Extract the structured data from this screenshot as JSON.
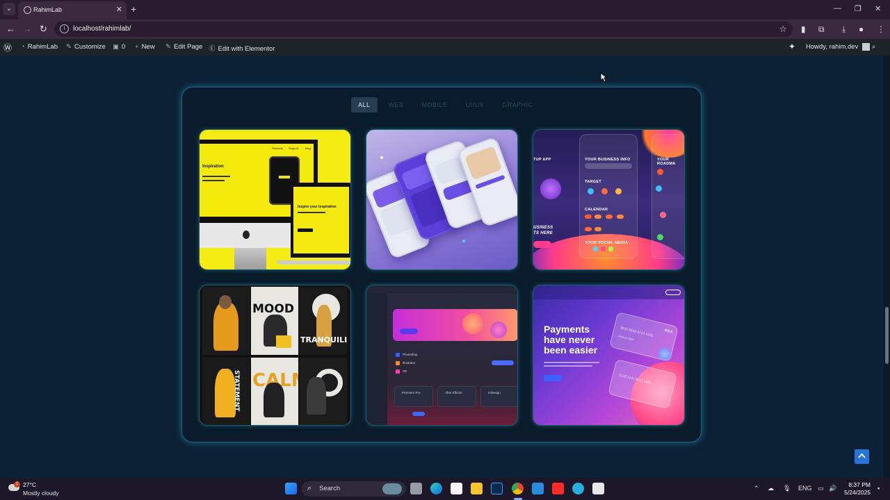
{
  "browser": {
    "tab_title": "RahimLab",
    "url": "localhost/rahimlab/",
    "window_controls": [
      "—",
      "❐",
      "✕"
    ]
  },
  "wp_admin_bar": {
    "site_name": "RahimLab",
    "customize": "Customize",
    "comments_count": "0",
    "new": "New",
    "edit_page": "Edit Page",
    "edit_elementor": "Edit with Elementor",
    "howdy": "Howdy, rahim.dev"
  },
  "portfolio": {
    "filters": [
      "ALL",
      "WEB",
      "MOBILE",
      "UI/UX",
      "GRAPHIC"
    ],
    "active_filter": "ALL",
    "items": [
      {
        "name": "yellow-web-mockup"
      },
      {
        "name": "mobile-app-mockup"
      },
      {
        "name": "startup-app-ui"
      },
      {
        "name": "poster-design-set"
      },
      {
        "name": "dashboard-ui"
      },
      {
        "name": "payments-landing"
      }
    ],
    "card1": {
      "heading": "Inspiration",
      "subheading": "Inspire your inspiration",
      "nav": [
        "Products",
        "Support",
        "Blog"
      ]
    },
    "card3": {
      "app_label": "TUP APP",
      "business_info": "YOUR BUSINESS INFO",
      "target": "TARGET",
      "calendar": "CALENDAR",
      "social": "YOUR SOCIAL MEDIA",
      "roadmap": "YOUR ROADMA",
      "business_line1": "USINESS",
      "business_line2": "TS HERE"
    },
    "card4": {
      "poster_words": [
        "MOOD",
        "TRANQUILITY",
        "STATEMENT",
        "CALM"
      ]
    },
    "card5": {
      "list": [
        "Photoshop",
        "Illustrator",
        "XD"
      ],
      "apps": [
        "Premiere Pro",
        "After Effects",
        "InDesign"
      ]
    },
    "card6": {
      "title": "Payments have never been easier",
      "card_number": "3516 8643 6714 4332",
      "card_number_2": "3128 1141 8423 0629",
      "holder": "Joshua Clark",
      "brand": "VISA"
    }
  },
  "taskbar": {
    "temperature": "27°C",
    "weather": "Mostly cloudy",
    "weather_badge": "1",
    "search": "Search",
    "lang": "ENG",
    "time": "8:37 PM",
    "date": "5/24/2025"
  },
  "colors": {
    "page_bg": "#0c2135",
    "accent_glow": "#28aad2",
    "active_filter_bg": "#263d52",
    "scroll_top_btn": "#2575d8"
  }
}
